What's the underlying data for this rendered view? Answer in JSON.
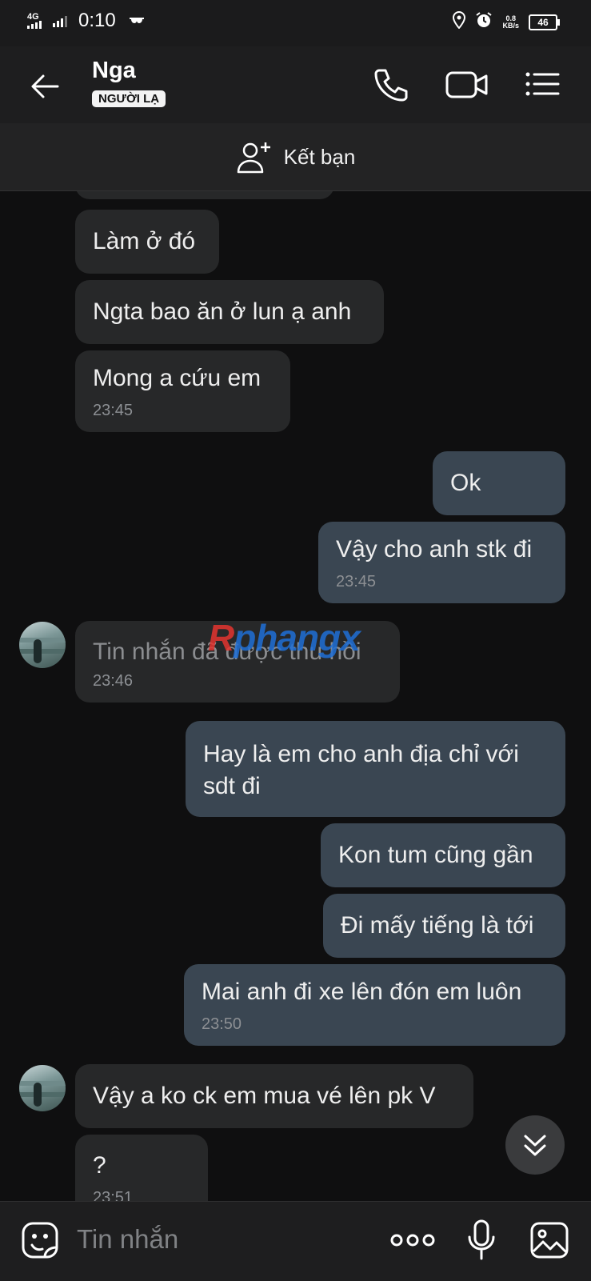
{
  "status_bar": {
    "network": "4G",
    "time": "0:10",
    "speed_value": "0.8",
    "speed_unit": "KB/s",
    "battery": "46"
  },
  "header": {
    "contact_name": "Nga",
    "badge": "NGƯỜI LẠ"
  },
  "friend_bar": {
    "label": "Kết bạn"
  },
  "messages": [
    {
      "dir": "in",
      "text": "Làm ở đó"
    },
    {
      "dir": "in",
      "text": "Ngta bao ăn ở lun ạ anh"
    },
    {
      "dir": "in",
      "text": "Mong a cứu em",
      "time": "23:45"
    },
    {
      "dir": "out",
      "text": "Ok"
    },
    {
      "dir": "out",
      "text": "Vậy cho anh stk đi",
      "time": "23:45"
    },
    {
      "dir": "in",
      "text": "Tin nhắn đã được thu hồi",
      "time": "23:46",
      "recalled": true
    },
    {
      "dir": "out",
      "text_line1": "Hay là em cho anh địa chỉ với",
      "text_line2": "sdt đi"
    },
    {
      "dir": "out",
      "text": "Kon tum cũng gần"
    },
    {
      "dir": "out",
      "text": "Đi mấy tiếng là tới"
    },
    {
      "dir": "out",
      "text": "Mai anh đi xe lên đón em luôn",
      "time": "23:50"
    },
    {
      "dir": "in",
      "text": "Vậy a ko ck em mua vé lên pk V"
    },
    {
      "dir": "in",
      "text": "?",
      "time": "23:51"
    }
  ],
  "watermark": {
    "part1": "R",
    "part2": "phangx"
  },
  "input_bar": {
    "placeholder": "Tin nhắn"
  },
  "colors": {
    "incoming_bubble": "#272829",
    "outgoing_bubble": "#3a4652",
    "background": "#0f0f10"
  }
}
